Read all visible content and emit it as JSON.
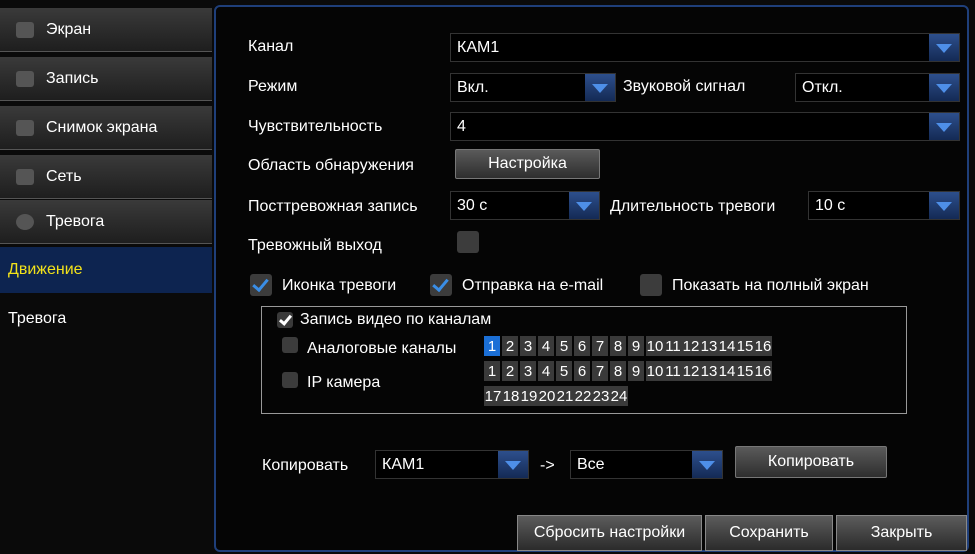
{
  "sidebar": {
    "items": [
      {
        "label": "Экран",
        "icon": "monitor-icon"
      },
      {
        "label": "Запись",
        "icon": "record-icon"
      },
      {
        "label": "Снимок экрана",
        "icon": "snapshot-icon"
      },
      {
        "label": "Сеть",
        "icon": "network-icon"
      },
      {
        "label": "Тревога",
        "icon": "alarm-icon"
      }
    ],
    "sub_items": [
      {
        "label": "Движение",
        "active": true
      },
      {
        "label": "Тревога",
        "active": false
      }
    ]
  },
  "form": {
    "channel_label": "Канал",
    "channel_value": "КАМ1",
    "mode_label": "Режим",
    "mode_value": "Вкл.",
    "buzzer_label": "Звуковой сигнал",
    "buzzer_value": "Откл.",
    "sensitivity_label": "Чувствительность",
    "sensitivity_value": "4",
    "area_label": "Область обнаружения",
    "area_button": "Настройка",
    "post_record_label": "Посттревожная запись",
    "post_record_value": "30 с",
    "alarm_duration_label": "Длительность тревоги",
    "alarm_duration_value": "10 с",
    "alarm_out_label": "Тревожный выход",
    "alarm_icon_label": "Иконка тревоги",
    "email_label": "Отправка на e-mail",
    "fullscreen_label": "Показать на полный экран"
  },
  "record_channels": {
    "title": "Запись видео по каналам",
    "analog_label": "Аналоговые каналы",
    "ip_label": "IP камера",
    "analog_channels": [
      "1",
      "2",
      "3",
      "4",
      "5",
      "6",
      "7",
      "8",
      "9",
      "10",
      "11",
      "12",
      "13",
      "14",
      "15",
      "16"
    ],
    "ip_channels_row1": [
      "1",
      "2",
      "3",
      "4",
      "5",
      "6",
      "7",
      "8",
      "9",
      "10",
      "11",
      "12",
      "13",
      "14",
      "15",
      "16"
    ],
    "ip_channels_row2": [
      "17",
      "18",
      "19",
      "20",
      "21",
      "22",
      "23",
      "24"
    ],
    "selected_analog": "1"
  },
  "copy": {
    "label": "Копировать",
    "from": "КАМ1",
    "arrow": "->",
    "to": "Все",
    "button": "Копировать"
  },
  "footer": {
    "reset": "Сбросить настройки",
    "save": "Сохранить",
    "close": "Закрыть"
  },
  "colors": {
    "accent": "#1b6fd6",
    "active_menu_text": "#f2e21a",
    "panel_border": "#1f3f7a"
  }
}
